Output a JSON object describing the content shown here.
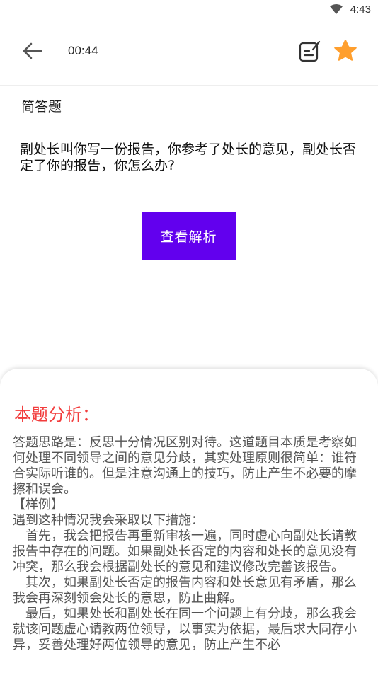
{
  "status_bar": {
    "time": "4:43",
    "wifi_icon": "wifi-icon"
  },
  "topbar": {
    "back_icon": "arrow-left-icon",
    "timer": "00:44",
    "note_icon": "note-edit-icon",
    "favorite_icon": "star-icon",
    "favorite_color": "#ff9f2e"
  },
  "question": {
    "type": "简答题",
    "text": "副处长叫你写一份报告，你参考了处长的意见，副处长否定了你的报告，你怎么办?"
  },
  "view_analysis_label": "查看解析",
  "accent_color": "#6200ee",
  "analysis": {
    "title": "本题分析：",
    "title_color": "#f23c3c",
    "paragraphs": [
      "答题思路是：反思十分情况区别对待。这道题目本质是考察如何处理不同领导之间的意见分歧，其实处理原则很简单：谁符合实际听谁的。但是注意沟通上的技巧，防止产生不必要的摩擦和误会。",
      "【样例】",
      "遇到这种情况我会采取以下措施：",
      "首先，我会把报告再重新审核一遍，同时虚心向副处长请教报告中存在的问题。如果副处长否定的内容和处长的意见没有冲突，那么我会根据副处长的意见和建议修改完善该报告。",
      "其次，如果副处长否定的报告内容和处长意见有矛盾，那么我会再深刻领会处长的意思，防止曲解。",
      "最后，如果处长和副处长在同一个问题上有分歧，那么我会就该问题虚心请教两位领导，以事实为依据，最后求大同存小异，妥善处理好两位领导的意见，防止产生不必"
    ]
  }
}
